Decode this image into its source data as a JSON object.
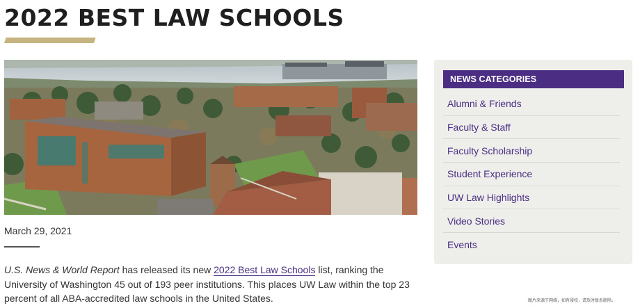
{
  "page": {
    "title": "2022 BEST LAW SCHOOLS",
    "date": "March 29, 2021"
  },
  "colors": {
    "accent_gold": "#c5b47f",
    "brand_purple": "#4b2e83",
    "sidebar_bg": "#eeeeeb"
  },
  "hero": {
    "alt_subject": "aerial-campus-photo"
  },
  "article": {
    "lede_italic": "U.S. News & World Report",
    "lede_part1": " has released its new ",
    "lede_link": "2022 Best Law Schools",
    "lede_part2": " list, ranking the University of Washington 45 out of 193 peer institutions. This places UW Law within the top 23 percent of all ABA-accredited law schools in the United States."
  },
  "sidebar": {
    "heading": "NEWS CATEGORIES",
    "items": [
      {
        "label": "Alumni & Friends"
      },
      {
        "label": "Faculty & Staff"
      },
      {
        "label": "Faculty Scholarship"
      },
      {
        "label": "Student Experience"
      },
      {
        "label": "UW Law Highlights"
      },
      {
        "label": "Video Stories"
      },
      {
        "label": "Events"
      }
    ]
  },
  "footer": {
    "fine_print": "图片来源于网络，如有侵权，请及时联系删除。"
  }
}
